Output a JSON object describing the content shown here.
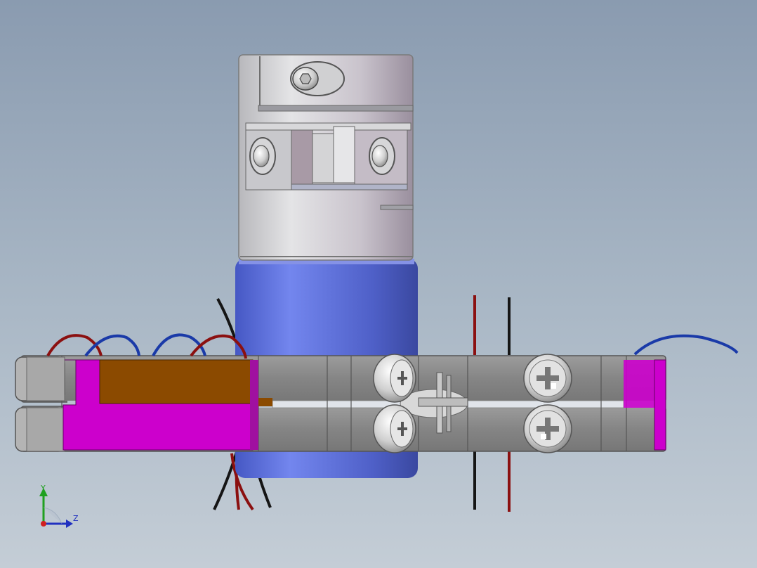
{
  "viewport": {
    "background_top": "#8a9bb0",
    "background_bottom": "#c4cdd6"
  },
  "model": {
    "coupling": {
      "color": "#c8c8cc"
    },
    "motor_body": {
      "color": "#5a6dd8"
    },
    "clamp_bars": {
      "color": "#8e8e8e"
    },
    "highlight_magenta": "#cc00cc",
    "highlight_brown": "#8b4a00",
    "wires": {
      "red": "#8b1010",
      "blue": "#1a3aa8",
      "black": "#151515"
    }
  },
  "triad": {
    "y_label": "Y",
    "z_label": "Z",
    "y_color": "#20a020",
    "z_color": "#2030c0",
    "origin_color": "#d02020"
  }
}
